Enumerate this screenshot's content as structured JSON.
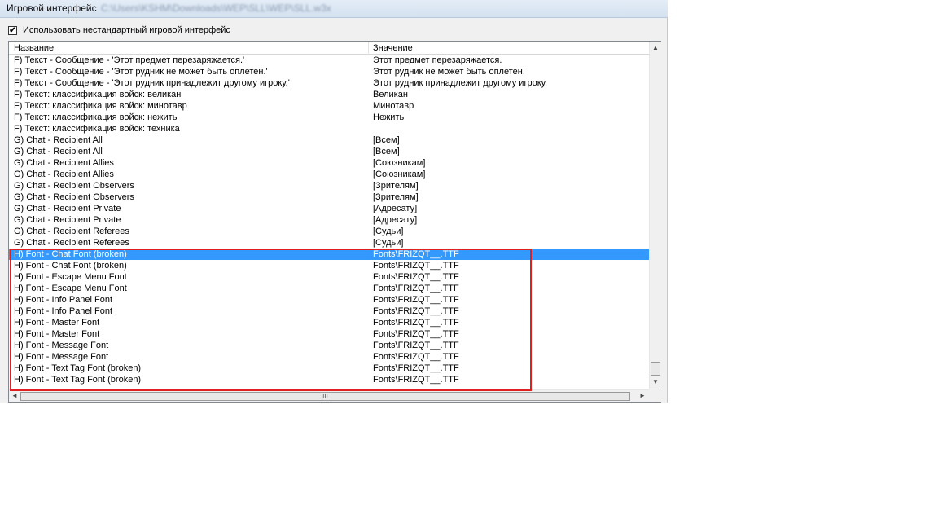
{
  "window": {
    "title": "Игровой интерфейс",
    "path": "C:\\Users\\KSHM\\Downloads\\WEP\\SLL\\WEP\\SLL.w3x"
  },
  "option": {
    "checked": true,
    "check_mark": "✔",
    "label": "Использовать нестандартный игровой интерфейс"
  },
  "table": {
    "columns": [
      "Название",
      "Значение"
    ],
    "rows": [
      {
        "name": "F) Текст - Сообщение - 'Этот предмет перезаряжается.'",
        "value": "Этот предмет перезаряжается."
      },
      {
        "name": "F) Текст - Сообщение - 'Этот рудник не может быть оплетен.'",
        "value": "Этот рудник не может быть оплетен."
      },
      {
        "name": "F) Текст - Сообщение - 'Этот рудник принадлежит другому игроку.'",
        "value": "Этот рудник принадлежит другому игроку."
      },
      {
        "name": "F) Текст: классификация войск: великан",
        "value": "Великан"
      },
      {
        "name": "F) Текст: классификация войск: минотавр",
        "value": "Минотавр"
      },
      {
        "name": "F) Текст: классификация войск: нежить",
        "value": "Нежить"
      },
      {
        "name": "F) Текст: классификация войск: техника",
        "value": ""
      },
      {
        "name": "G) Chat - Recipient All",
        "value": "[Всем]"
      },
      {
        "name": "G) Chat - Recipient All",
        "value": "[Всем]"
      },
      {
        "name": "G) Chat - Recipient Allies",
        "value": "[Союзникам]"
      },
      {
        "name": "G) Chat - Recipient Allies",
        "value": "[Союзникам]"
      },
      {
        "name": "G) Chat - Recipient Observers",
        "value": "[Зрителям]"
      },
      {
        "name": "G) Chat - Recipient Observers",
        "value": "[Зрителям]"
      },
      {
        "name": "G) Chat - Recipient Private",
        "value": "[Адресату]"
      },
      {
        "name": "G) Chat - Recipient Private",
        "value": "[Адресату]"
      },
      {
        "name": "G) Chat - Recipient Referees",
        "value": "[Судьи]"
      },
      {
        "name": "G) Chat - Recipient Referees",
        "value": "[Судьи]"
      },
      {
        "name": "H) Font - Chat Font (broken)",
        "value": "Fonts\\FRIZQT__.TTF",
        "selected": true
      },
      {
        "name": "H) Font - Chat Font (broken)",
        "value": "Fonts\\FRIZQT__.TTF"
      },
      {
        "name": "H) Font - Escape Menu Font",
        "value": "Fonts\\FRIZQT__.TTF"
      },
      {
        "name": "H) Font - Escape Menu Font",
        "value": "Fonts\\FRIZQT__.TTF"
      },
      {
        "name": "H) Font - Info Panel Font",
        "value": "Fonts\\FRIZQT__.TTF"
      },
      {
        "name": "H) Font - Info Panel Font",
        "value": "Fonts\\FRIZQT__.TTF"
      },
      {
        "name": "H) Font - Master Font",
        "value": "Fonts\\FRIZQT__.TTF"
      },
      {
        "name": "H) Font - Master Font",
        "value": "Fonts\\FRIZQT__.TTF"
      },
      {
        "name": "H) Font - Message Font",
        "value": "Fonts\\FRIZQT__.TTF"
      },
      {
        "name": "H) Font - Message Font",
        "value": "Fonts\\FRIZQT__.TTF"
      },
      {
        "name": "H) Font - Text Tag Font (broken)",
        "value": "Fonts\\FRIZQT__.TTF"
      },
      {
        "name": "H) Font - Text Tag Font (broken)",
        "value": "Fonts\\FRIZQT__.TTF"
      }
    ]
  },
  "scrollbar": {
    "up_icon": "▲",
    "down_icon": "▼",
    "left_icon": "◄",
    "right_icon": "►",
    "grip": "III"
  },
  "colors": {
    "selection": "#3399ff",
    "highlight_box": "#e02020"
  }
}
